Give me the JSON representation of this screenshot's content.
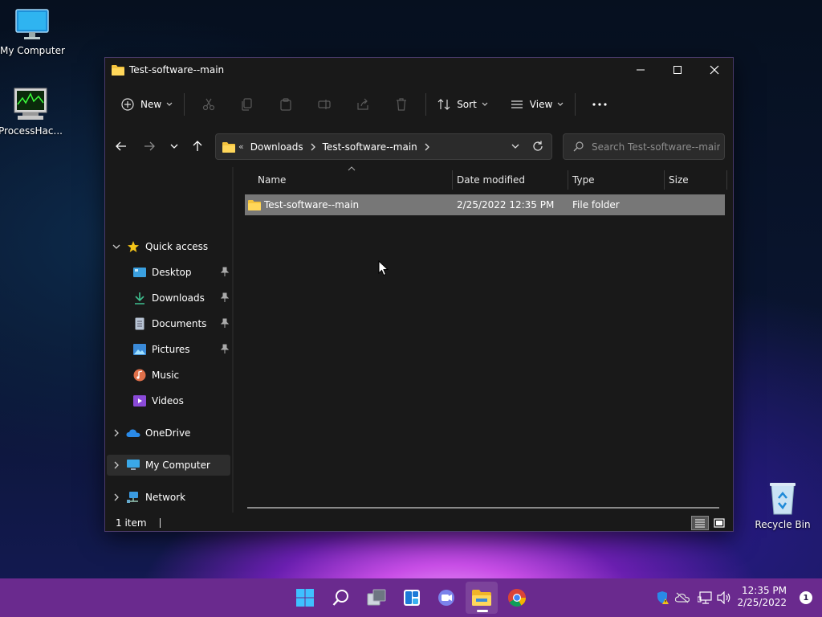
{
  "desktop": {
    "icons": [
      {
        "label": "My Computer"
      },
      {
        "label": "ProcessHac..."
      },
      {
        "label": "Recycle Bin"
      }
    ]
  },
  "window": {
    "title": "Test-software--main",
    "toolbar": {
      "new_label": "New",
      "sort_label": "Sort",
      "view_label": "View"
    },
    "address": {
      "overflow": "«",
      "crumbs": [
        "Downloads",
        "Test-software--main"
      ]
    },
    "search": {
      "placeholder": "Search Test-software--main"
    },
    "nav": {
      "quick_access": "Quick access",
      "items": [
        {
          "label": "Desktop"
        },
        {
          "label": "Downloads"
        },
        {
          "label": "Documents"
        },
        {
          "label": "Pictures"
        },
        {
          "label": "Music"
        },
        {
          "label": "Videos"
        }
      ],
      "onedrive": "OneDrive",
      "my_computer": "My Computer",
      "network": "Network"
    },
    "columns": {
      "name": "Name",
      "date": "Date modified",
      "type": "Type",
      "size": "Size"
    },
    "files": [
      {
        "name": "Test-software--main",
        "date": "2/25/2022 12:35 PM",
        "type": "File folder",
        "size": ""
      }
    ],
    "status": "1 item"
  },
  "taskbar": {
    "clock_time": "12:35 PM",
    "clock_date": "2/25/2022",
    "notification_count": "1",
    "accent": "#6a2a8e"
  }
}
